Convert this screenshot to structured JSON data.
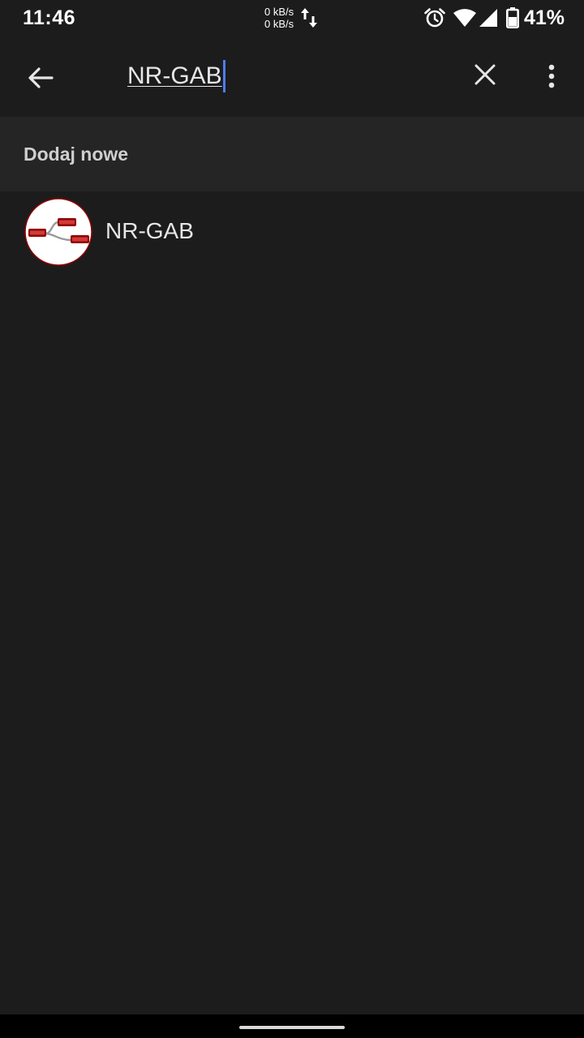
{
  "status_bar": {
    "time": "11:46",
    "upload_speed": "0 kB/s",
    "download_speed": "0 kB/s",
    "battery_percent": "41%",
    "icons": [
      "data-arrows-icon",
      "alarm-icon",
      "wifi-icon",
      "cell-signal-icon",
      "battery-icon"
    ]
  },
  "toolbar": {
    "search_value": "NR-GAB",
    "icons": [
      "back-arrow-icon",
      "close-icon",
      "more-vert-icon"
    ]
  },
  "section": {
    "title": "Dodaj nowe"
  },
  "results": [
    {
      "label": "NR-GAB",
      "icon": "node-red-logo"
    }
  ],
  "colors": {
    "background": "#1c1c1c",
    "section_background": "#252525",
    "cursor": "#4f7cf7",
    "logo_red": "#8f0000"
  }
}
